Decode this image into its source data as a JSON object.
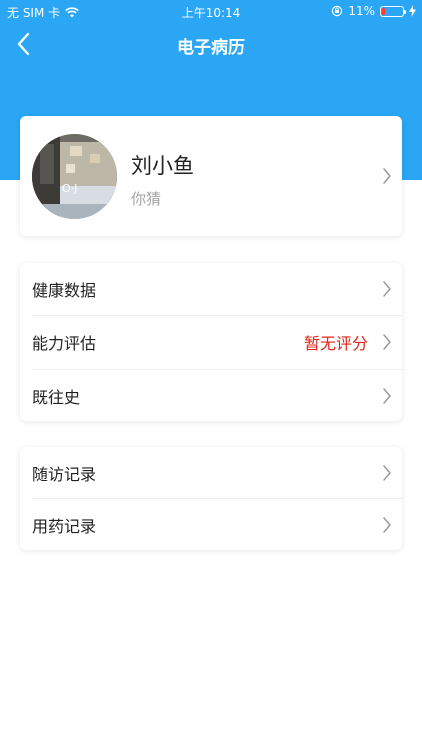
{
  "status_bar": {
    "carrier": "无 SIM 卡",
    "time": "上午10:14",
    "battery_percent": "11%",
    "battery_level": 0.11
  },
  "nav": {
    "title": "电子病历"
  },
  "profile": {
    "name": "刘小鱼",
    "subtitle": "你猜"
  },
  "section1": {
    "rows": [
      {
        "label": "健康数据",
        "value": ""
      },
      {
        "label": "能力评估",
        "value": "暂无评分"
      },
      {
        "label": "既往史",
        "value": ""
      }
    ]
  },
  "section2": {
    "rows": [
      {
        "label": "随访记录"
      },
      {
        "label": "用药记录"
      }
    ]
  },
  "colors": {
    "primary": "#2aa6f5",
    "value_red": "#e1251b",
    "muted": "#a3a3a3"
  },
  "icons": [
    "wifi-icon",
    "rotation-lock-icon",
    "battery-icon",
    "charging-icon",
    "back-chevron-icon",
    "chevron-right-icon"
  ]
}
